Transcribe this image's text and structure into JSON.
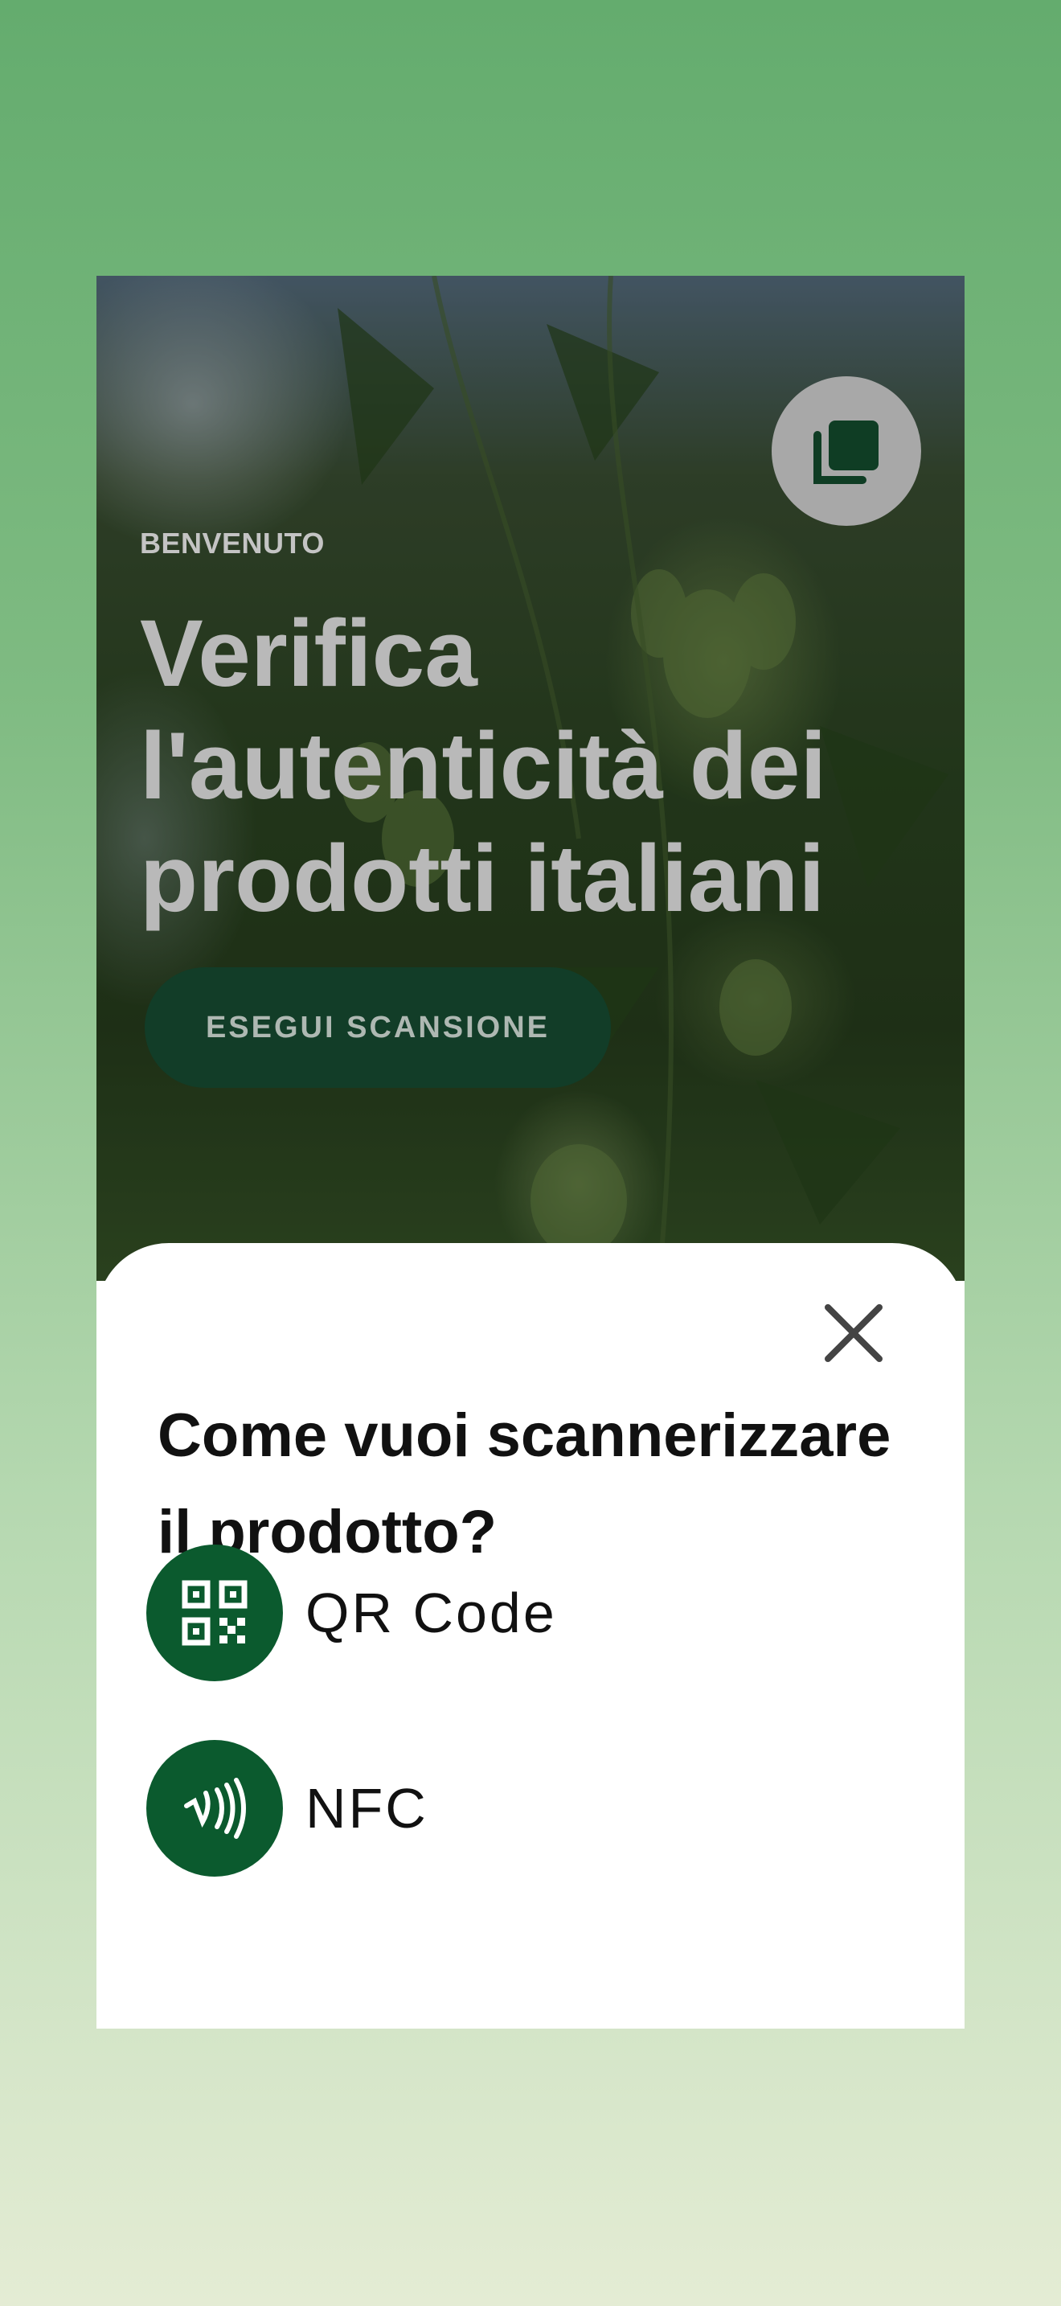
{
  "hero": {
    "eyebrow": "BENVENUTO",
    "title": "Verifica l'autenticità dei prodotti italiani",
    "scan_button_label": "ESEGUI SCANSIONE",
    "collection_icon": "collection-icon"
  },
  "sheet": {
    "title": "Come vuoi scannerizzare il prodotto?",
    "close_icon": "close-icon",
    "options": [
      {
        "label": "QR Code",
        "icon": "qr-code-icon"
      },
      {
        "label": "NFC",
        "icon": "nfc-icon"
      }
    ]
  },
  "colors": {
    "accent": "#0b5a2e",
    "scan_button": "#123d28",
    "background_top": "#64ac6e",
    "background_bottom": "#e4ecd4"
  }
}
